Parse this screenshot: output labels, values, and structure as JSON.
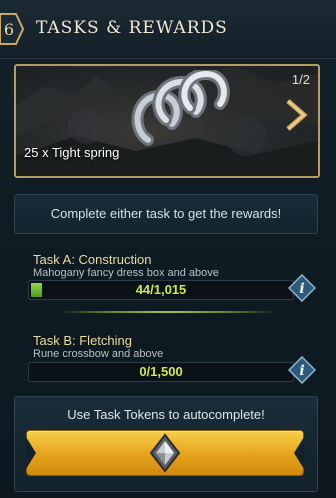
{
  "header": {
    "level_badge": "6",
    "title": "TASKS & REWARDS"
  },
  "reward": {
    "page_indicator": "1/2",
    "item_name": "25 x Tight spring",
    "icon": "tight-spring-icon"
  },
  "info_text": "Complete either task to get the rewards!",
  "tasks": [
    {
      "title": "Task A: Construction",
      "subtitle": "Mahogany fancy dress box and above",
      "progress_text": "44/1,015",
      "progress_fraction": 0.0433
    },
    {
      "title": "Task B: Fletching",
      "subtitle": "Rune crossbow and above",
      "progress_text": "0/1,500",
      "progress_fraction": 0
    }
  ],
  "tokens": {
    "label": "Use Task Tokens to autocomplete!",
    "button_icon": "task-token-icon"
  },
  "colors": {
    "gold_border": "#b79c62",
    "progress_text": "#cfe84a",
    "button_gold": "#e6a21a"
  }
}
